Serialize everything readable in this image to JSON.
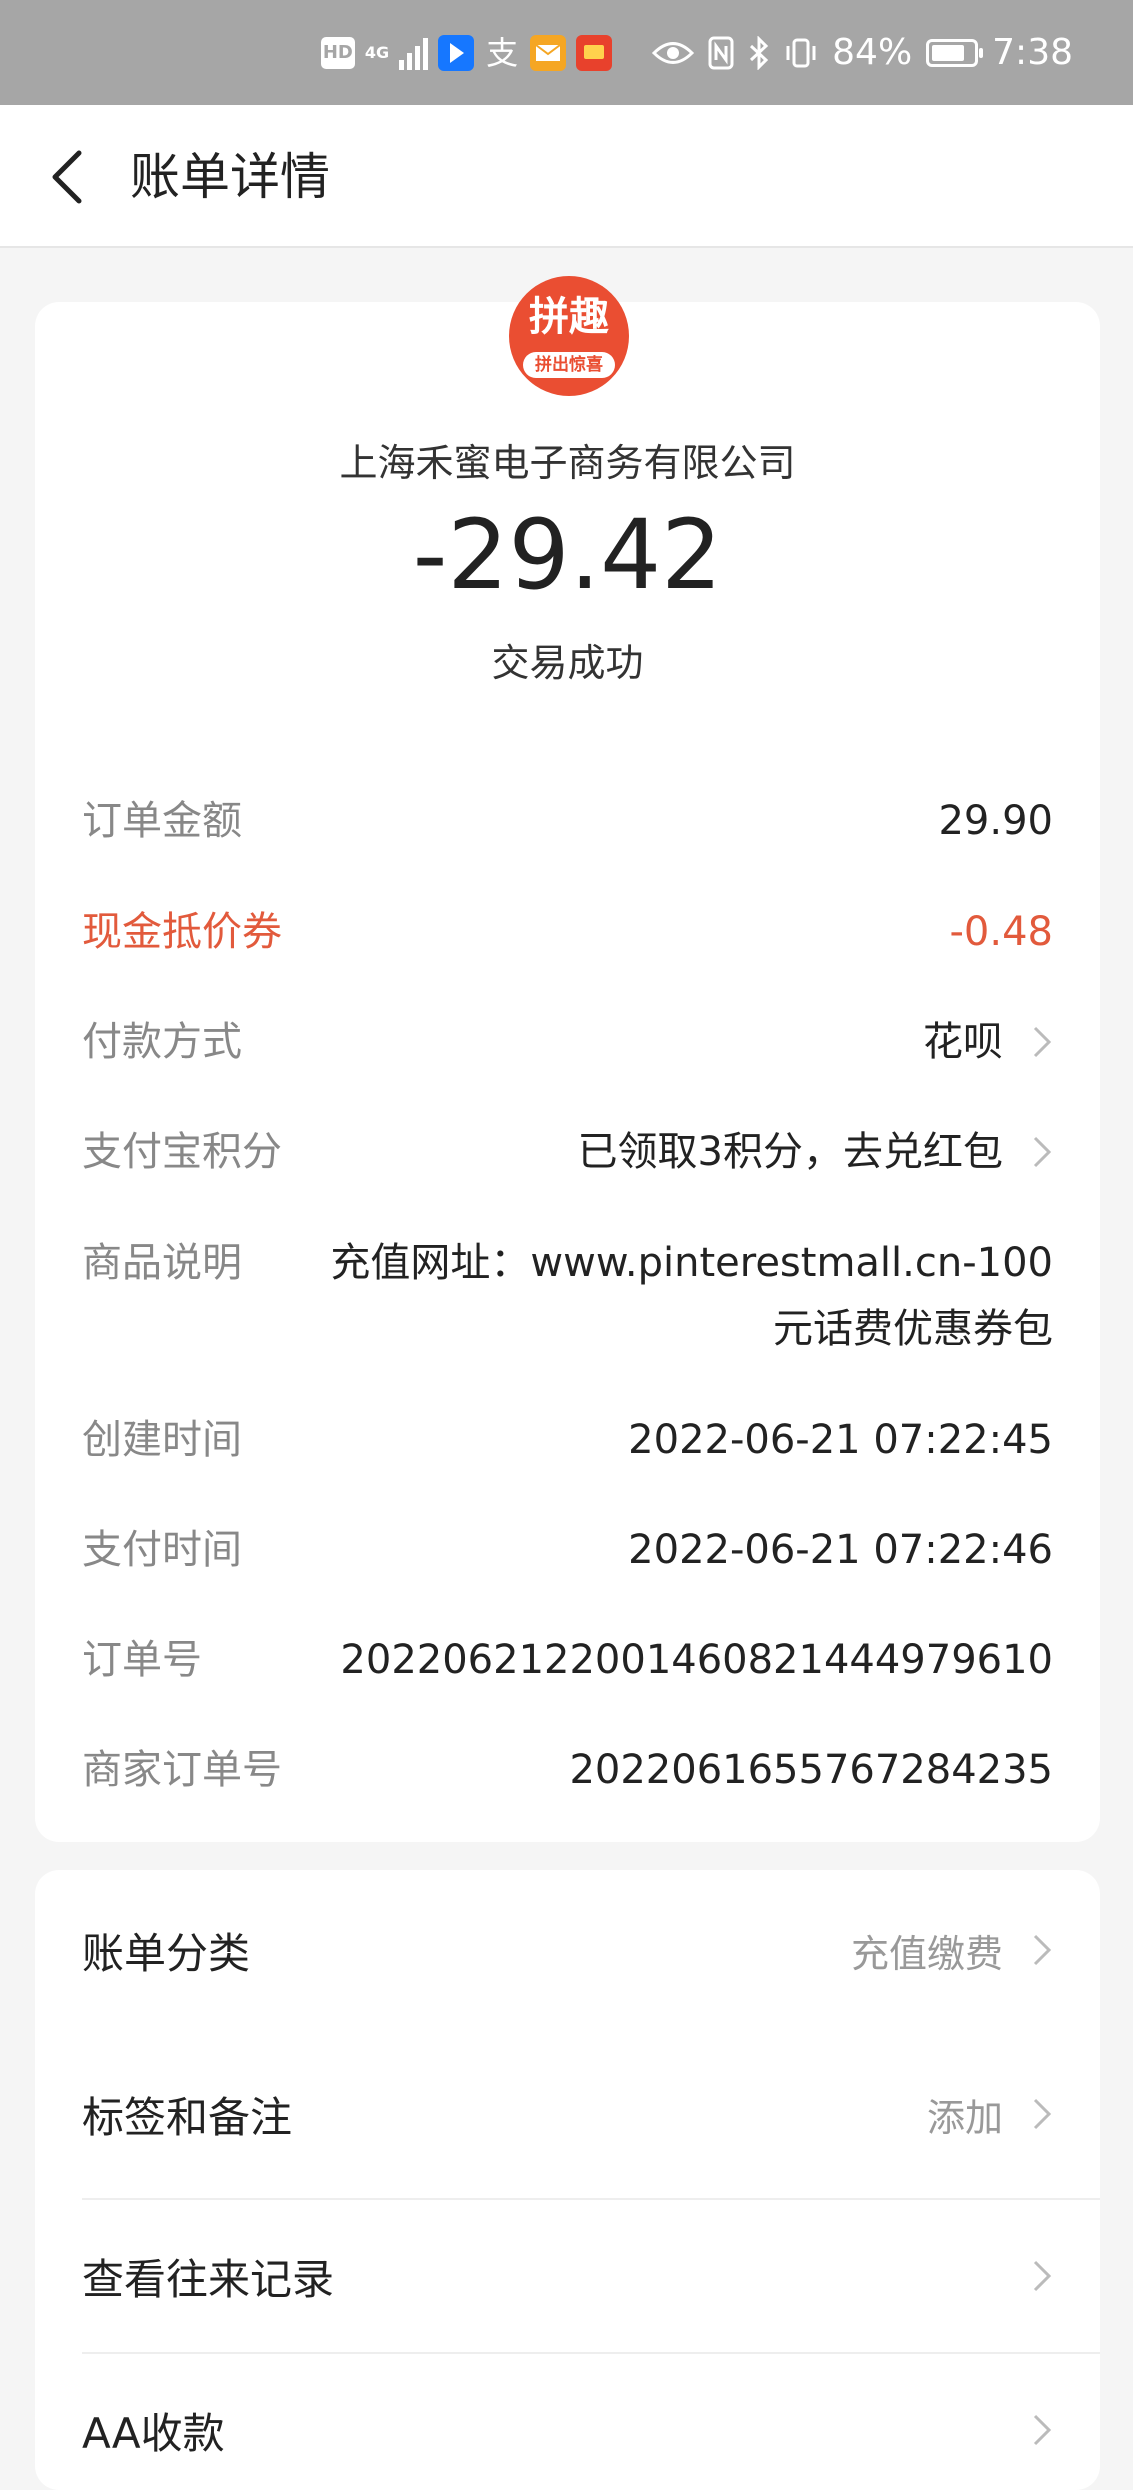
{
  "status_bar": {
    "hd": "HD",
    "network": "4G",
    "alipay_glyph": "支",
    "battery": "84%",
    "time": "7:38"
  },
  "nav": {
    "title": "账单详情"
  },
  "header": {
    "logo_text": "拼趣",
    "logo_sub": "拼出惊喜",
    "merchant": "上海禾蜜电子商务有限公司",
    "amount": "-29.42",
    "status": "交易成功"
  },
  "details": {
    "order_amount_label": "订单金额",
    "order_amount_value": "29.90",
    "coupon_label": "现金抵价券",
    "coupon_value": "-0.48",
    "payment_label": "付款方式",
    "payment_value": "花呗",
    "points_label": "支付宝积分",
    "points_value": "已领取3积分，去兑红包",
    "desc_label": "商品说明",
    "desc_value_1": "充值网址：www.pinterestmall.cn-100",
    "desc_value_2": "元话费优惠券包",
    "created_label": "创建时间",
    "created_value": "2022-06-21 07:22:45",
    "paid_label": "支付时间",
    "paid_value": "2022-06-21 07:22:46",
    "order_no_label": "订单号",
    "order_no_value": "2022062122001460821444979610",
    "merchant_order_label": "商家订单号",
    "merchant_order_value": "2022061655767284235"
  },
  "actions": {
    "category_label": "账单分类",
    "category_value": "充值缴费",
    "tags_label": "标签和备注",
    "tags_value": "添加",
    "history_label": "查看往来记录",
    "aa_label": "AA收款"
  },
  "colors": {
    "accent_red": "#e25a3c",
    "logo_red": "#ea4e32"
  }
}
